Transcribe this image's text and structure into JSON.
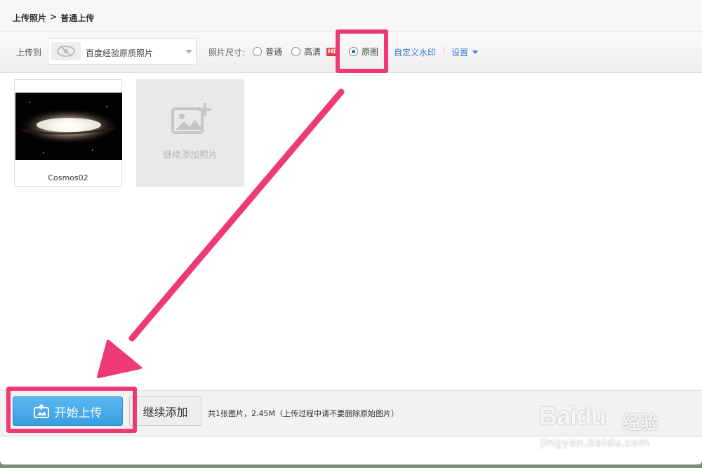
{
  "header": {
    "breadcrumb": [
      "上传照片",
      ">",
      "普通上传"
    ]
  },
  "toolbar": {
    "upload_to_label": "上传到",
    "album_name": "百度经验原质照片",
    "album_icon": "eye-slash-icon",
    "size_label": "照片尺寸:",
    "sizes": [
      {
        "label": "普通",
        "checked": false
      },
      {
        "label": "高清",
        "checked": false,
        "badge": "HD"
      },
      {
        "label": "原图",
        "checked": true
      }
    ],
    "watermark_link": "自定义水印",
    "separator": "|",
    "settings_label": "设置"
  },
  "photos": [
    {
      "name": "Cosmos02"
    }
  ],
  "add_card": {
    "label": "继续添加照片",
    "icon": "add-image-icon"
  },
  "footer": {
    "start_button": "开始上传",
    "start_icon": "upload-album-icon",
    "continue_button": "继续添加",
    "summary": "共1张图片，2.45M（上传过程中请不要删除原始图片）"
  },
  "annotation": {
    "color": "#ee3a74"
  },
  "watermark": {
    "logo_text": "Baidu",
    "cn_text": "经验",
    "url": "jingyan.baidu.com"
  },
  "colors": {
    "accent": "#3a9fe0",
    "link": "#3a7bd5",
    "hd_badge": "#e04040"
  }
}
